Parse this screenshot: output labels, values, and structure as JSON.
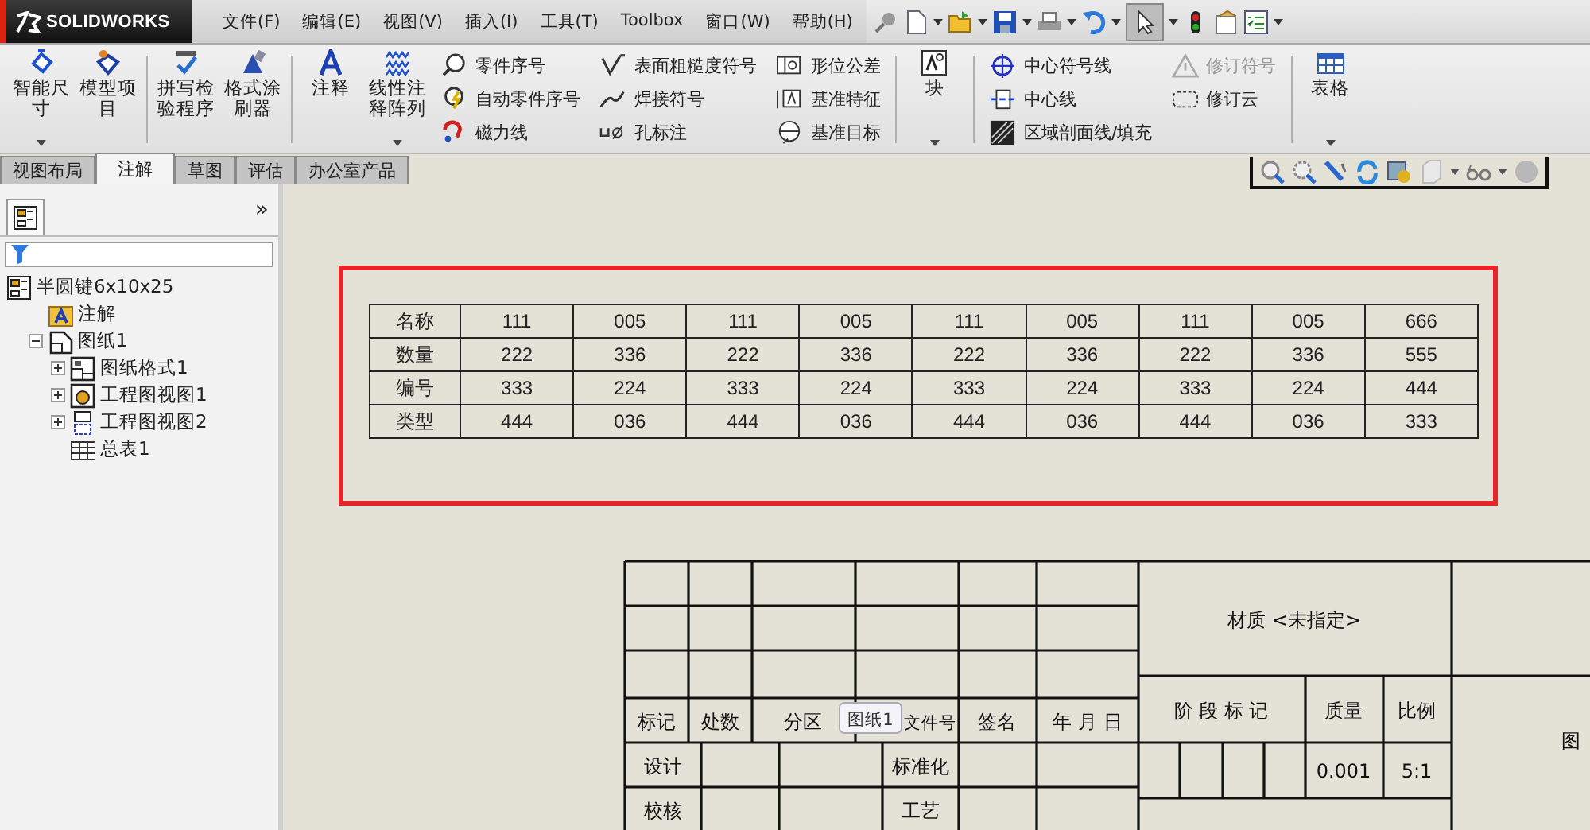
{
  "app": {
    "logo": "SOLIDWORKS"
  },
  "menu": [
    "文件(F)",
    "编辑(E)",
    "视图(V)",
    "插入(I)",
    "工具(T)",
    "Toolbox",
    "窗口(W)",
    "帮助(H)"
  ],
  "ribbon": {
    "sections": [
      [
        {
          "kind": "large",
          "label": "智能尺寸",
          "dropdown": true
        },
        {
          "kind": "large",
          "label": "模型项目",
          "dropdown": false
        }
      ],
      [
        {
          "kind": "large",
          "label": "拼写检验程序",
          "dropdown": false
        },
        {
          "kind": "large",
          "label": "格式涂刷器",
          "dropdown": false
        }
      ],
      [
        {
          "kind": "large",
          "label": "注释",
          "dropdown": false
        },
        {
          "kind": "large",
          "label": "线性注释阵列",
          "dropdown": true
        },
        {
          "kind": "stack",
          "entries": [
            {
              "label": "零件序号",
              "disabled": false
            },
            {
              "label": "自动零件序号",
              "disabled": false
            },
            {
              "label": "磁力线",
              "disabled": false
            }
          ]
        },
        {
          "kind": "stack",
          "entries": [
            {
              "label": "表面粗糙度符号",
              "disabled": false
            },
            {
              "label": "焊接符号",
              "disabled": false
            },
            {
              "label": "孔标注",
              "disabled": false
            }
          ]
        },
        {
          "kind": "stack",
          "entries": [
            {
              "label": "形位公差",
              "disabled": false
            },
            {
              "label": "基准特征",
              "disabled": false
            },
            {
              "label": "基准目标",
              "disabled": false
            }
          ]
        }
      ],
      [
        {
          "kind": "large",
          "label": "块",
          "dropdown": true
        }
      ],
      [
        {
          "kind": "stack",
          "entries": [
            {
              "label": "中心符号线",
              "disabled": false
            },
            {
              "label": "中心线",
              "disabled": false
            },
            {
              "label": "区域剖面线/填充",
              "disabled": false
            }
          ]
        },
        {
          "kind": "stack",
          "entries": [
            {
              "label": "修订符号",
              "disabled": true
            },
            {
              "label": "修订云",
              "disabled": false
            }
          ]
        }
      ],
      [
        {
          "kind": "large",
          "label": "表格",
          "dropdown": true
        }
      ]
    ]
  },
  "tabs": [
    {
      "label": "视图布局",
      "selected": false
    },
    {
      "label": "注解",
      "selected": true
    },
    {
      "label": "草图",
      "selected": false
    },
    {
      "label": "评估",
      "selected": false
    },
    {
      "label": "办公室产品",
      "selected": false
    }
  ],
  "panel": {
    "expand": "»",
    "tree": [
      {
        "label": "半圆键6x10x25",
        "children": [
          {
            "label": "注解"
          },
          {
            "label": "图纸1",
            "expanded": true,
            "children": [
              {
                "label": "图纸格式1",
                "expanded": false
              },
              {
                "label": "工程图视图1",
                "expanded": false
              },
              {
                "label": "工程图视图2",
                "expanded": false
              },
              {
                "label": "总表1"
              }
            ]
          }
        ]
      }
    ]
  },
  "table": {
    "rows": [
      [
        "名称",
        "111",
        "005",
        "111",
        "005",
        "111",
        "005",
        "111",
        "005",
        "666"
      ],
      [
        "数量",
        "222",
        "336",
        "222",
        "336",
        "222",
        "336",
        "222",
        "336",
        "555"
      ],
      [
        "编号",
        "333",
        "224",
        "333",
        "224",
        "333",
        "224",
        "333",
        "224",
        "444"
      ],
      [
        "类型",
        "444",
        "036",
        "444",
        "036",
        "444",
        "036",
        "444",
        "036",
        "333"
      ]
    ]
  },
  "title_block": {
    "revision_headers": [
      "标记",
      "处数",
      "分区",
      "文件号",
      "签名",
      "年 月 日"
    ],
    "sign_rows": [
      [
        "设计",
        "标准化"
      ],
      [
        "校核",
        "工艺"
      ]
    ],
    "material": "材质 <未指定>",
    "stage_header": "阶 段 标 记",
    "mass_header": "质量",
    "scale_header": "比例",
    "mass": "0.001",
    "scale": "5:1",
    "edge_text": "图"
  },
  "tooltip": "图纸1"
}
